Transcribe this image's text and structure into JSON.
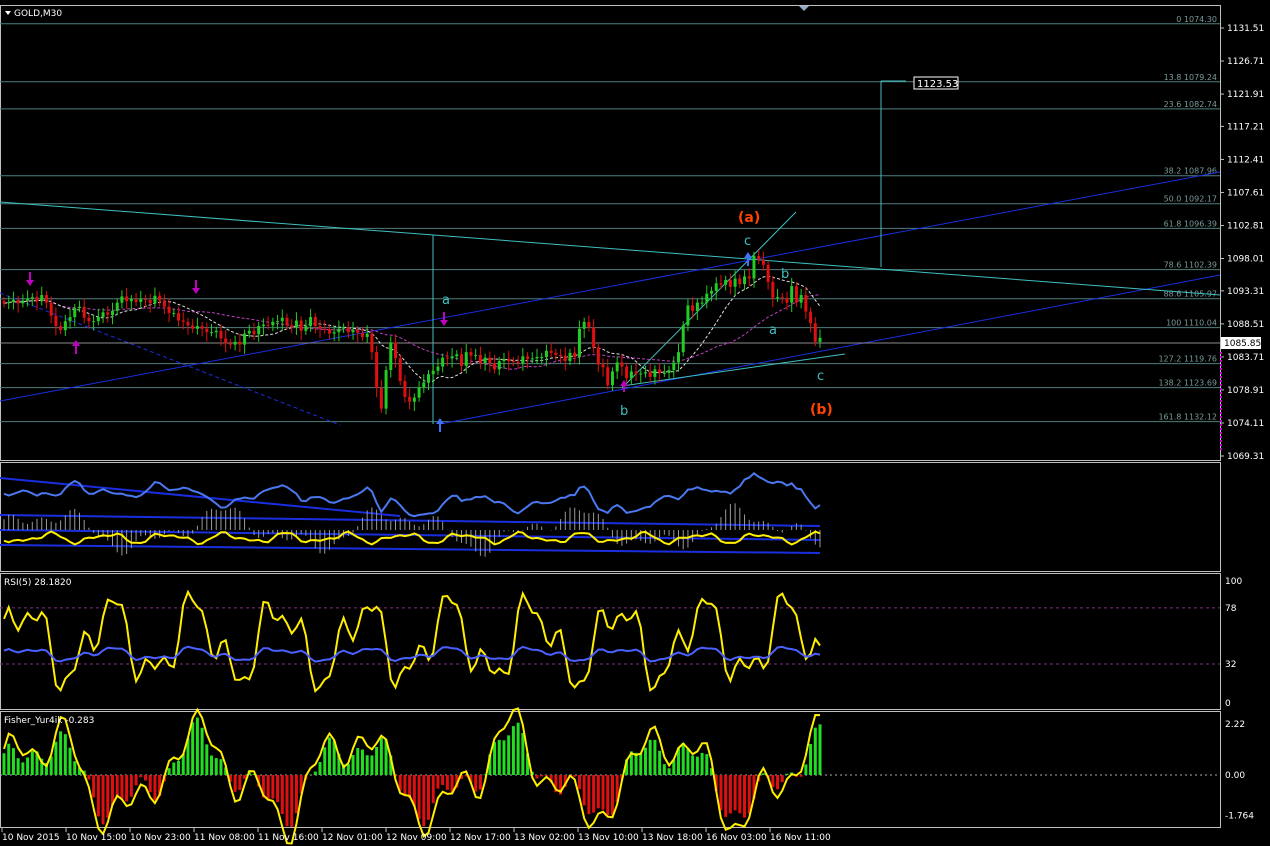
{
  "window": {
    "title": "GOLD,M30"
  },
  "price_axis": {
    "ticks": [
      "1131.51",
      "1126.71",
      "1121.91",
      "1117.21",
      "1112.41",
      "1107.61",
      "1102.81",
      "1098.01",
      "1093.31",
      "1088.51",
      "1083.71",
      "1078.91",
      "1074.11",
      "1069.31"
    ],
    "current_price": "1085.85",
    "target_price": "1123.53"
  },
  "time_axis": {
    "ticks": [
      "10 Nov 2015",
      "10 Nov 15:00",
      "10 Nov 23:00",
      "11 Nov 08:00",
      "11 Nov 16:00",
      "12 Nov 01:00",
      "12 Nov 09:00",
      "12 Nov 17:00",
      "13 Nov 02:00",
      "13 Nov 10:00",
      "13 Nov 18:00",
      "16 Nov 03:00",
      "16 Nov 11:00"
    ]
  },
  "fibonacci_levels": [
    "161.8 1132.12",
    "138.2 1123.69",
    "127.2 1119.76",
    "100 1110.04",
    "88.6 1105.97",
    "78.6 1102.39",
    "61.8 1096.39",
    "50.0 1092.17",
    "38.2 1087.96",
    "23.6 1082.74",
    "13.8 1079.24",
    "0 1074.30"
  ],
  "wave_labels": {
    "a_major": "(a)",
    "b_major": "(b)",
    "a": "a",
    "b": "b",
    "c": "c",
    "b_low": "b",
    "c_top": "c",
    "b_right": "b",
    "a_right": "a",
    "c_end": "c"
  },
  "rsi_panel": {
    "label": "RSI(5) 28.1820",
    "ticks": [
      "100",
      "78",
      "32",
      "0"
    ]
  },
  "fisher_panel": {
    "label": "Fisher_Yur4ik -0.283",
    "ticks": [
      "2.22",
      "0.00",
      "-1.764"
    ]
  },
  "colors": {
    "background": "#000000",
    "bull_candle": "#22cc22",
    "bear_candle": "#e01010",
    "fib": "#5f8f8f",
    "trendline": "#1a2ee0",
    "cyan_line": "#40c0c0",
    "yellow": "#ffee00",
    "magenta": "#a020a0",
    "wave_orange": "#ff4400",
    "wave_cyan": "#40c0c0"
  },
  "chart_data": {
    "type": "candlestick",
    "title": "GOLD,M30",
    "ylim": [
      1069.3,
      1131.5
    ],
    "close_series": [
      1091.5,
      1091.7,
      1092.0,
      1091.5,
      1091.9,
      1092.2,
      1092.4,
      1091.8,
      1092.7,
      1091.6,
      1089.7,
      1088.2,
      1087.6,
      1088.9,
      1089.5,
      1090.8,
      1091.0,
      1089.4,
      1088.9,
      1088.9,
      1089.5,
      1090.2,
      1089.8,
      1090.4,
      1091.6,
      1092.5,
      1091.8,
      1092.1,
      1091.7,
      1092.1,
      1092.0,
      1091.5,
      1092.6,
      1091.9,
      1091.0,
      1090.1,
      1090.1,
      1089.0,
      1088.8,
      1088.3,
      1087.8,
      1088.2,
      1087.8,
      1087.3,
      1087.3,
      1087.5,
      1086.4,
      1085.7,
      1085.5,
      1085.9,
      1085.5,
      1087.1,
      1087.5,
      1087.0,
      1088.2,
      1088.4,
      1088.3,
      1088.8,
      1088.9,
      1089.4,
      1088.3,
      1088.0,
      1089.0,
      1087.5,
      1088.2,
      1089.5,
      1088.2,
      1087.8,
      1087.7,
      1087.1,
      1087.3,
      1087.8,
      1088.0,
      1087.3,
      1087.6,
      1087.2,
      1086.6,
      1087.1,
      1084.4,
      1079.2,
      1076.2,
      1081.8,
      1085.8,
      1083.5,
      1080.2,
      1077.9,
      1077.2,
      1077.8,
      1079.3,
      1080.0,
      1081.2,
      1081.7,
      1082.3,
      1083.6,
      1083.5,
      1083.8,
      1084.1,
      1082.4,
      1084.4,
      1083.9,
      1084.0,
      1082.8,
      1083.6,
      1082.8,
      1081.9,
      1083.1,
      1083.4,
      1083.1,
      1083.0,
      1082.8,
      1083.8,
      1083.4,
      1083.5,
      1083.7,
      1083.7,
      1084.6,
      1084.3,
      1084.0,
      1083.9,
      1083.1,
      1084.3,
      1083.7,
      1087.8,
      1088.8,
      1088.0,
      1085.1,
      1082.6,
      1082.2,
      1079.6,
      1081.6,
      1082.9,
      1082.3,
      1080.6,
      1081.6,
      1081.3,
      1081.3,
      1081.5,
      1080.8,
      1081.9,
      1081.4,
      1081.4,
      1081.8,
      1082.9,
      1084.4,
      1088.3,
      1091.2,
      1090.4,
      1091.6,
      1091.6,
      1092.9,
      1093.3,
      1094.4,
      1094.2,
      1094.9,
      1093.9,
      1095.1,
      1094.3,
      1095.4,
      1095.1,
      1098.4,
      1097.8,
      1097.1,
      1094.6,
      1092.3,
      1092.4,
      1092.3,
      1091.6,
      1094.0,
      1091.6,
      1092.7,
      1090.3,
      1088.6,
      1085.9,
      1086.5
    ],
    "x_ticks": [
      "10 Nov 2015",
      "10 Nov 15:00",
      "10 Nov 23:00",
      "11 Nov 08:00",
      "11 Nov 16:00",
      "12 Nov 01:00",
      "12 Nov 09:00",
      "12 Nov 17:00",
      "13 Nov 02:00",
      "13 Nov 10:00",
      "13 Nov 18:00",
      "16 Nov 03:00",
      "16 Nov 11:00"
    ],
    "fib_retracement": [
      {
        "level": "0",
        "price": 1074.3
      },
      {
        "level": "13.8",
        "price": 1079.24
      },
      {
        "level": "23.6",
        "price": 1082.74
      },
      {
        "level": "38.2",
        "price": 1087.96
      },
      {
        "level": "50.0",
        "price": 1092.17
      },
      {
        "level": "61.8",
        "price": 1096.39
      },
      {
        "level": "78.6",
        "price": 1102.39
      },
      {
        "level": "88.6",
        "price": 1105.97
      },
      {
        "level": "100",
        "price": 1110.04
      },
      {
        "level": "127.2",
        "price": 1119.76
      },
      {
        "level": "138.2",
        "price": 1123.69
      },
      {
        "level": "161.8",
        "price": 1132.12
      }
    ]
  }
}
